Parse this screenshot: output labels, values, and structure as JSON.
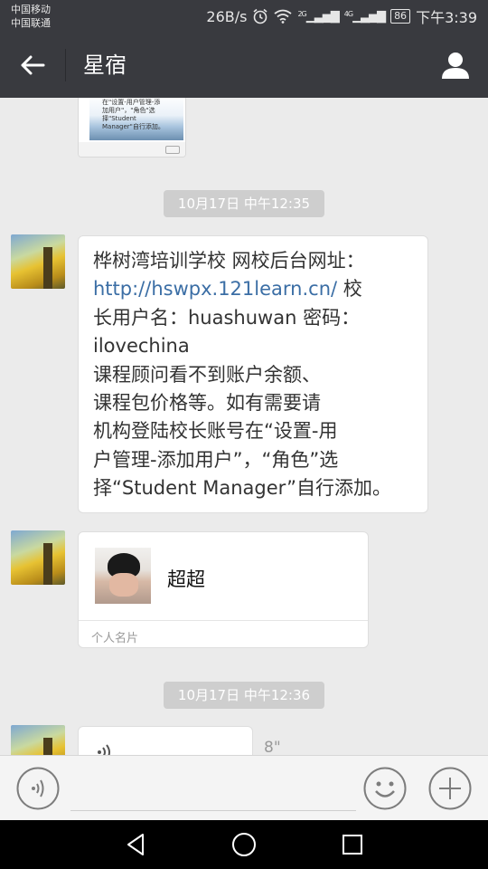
{
  "status_bar": {
    "carrier1": "中国移动",
    "carrier2": "中国联通",
    "speed": "26B/s",
    "alarm_icon": "alarm-icon",
    "wifi_icon": "wifi-icon",
    "signal1_label": "2G",
    "signal2_label": "4G",
    "battery": "86",
    "time": "下午3:39"
  },
  "header": {
    "title": "星宿",
    "back_icon": "arrow-left-icon",
    "profile_icon": "person-icon"
  },
  "messages": {
    "prev_image_text": "在\"设置-用户管理-添加用户\"，\"角色\"选择\"Student Manager\"自行添加。",
    "time1": "10月17日 中午12:35",
    "text_line1": "桦树湾培训学校 网校后台网址：",
    "text_link": "http://hswpx.121learn.cn/",
    "text_line2_tail": " 校",
    "text_line3": "长用户名：huashuwan  密码：",
    "text_line4": "ilovechina",
    "text_line5": "课程顾问看不到账户余额、",
    "text_line6": "课程包价格等。如有需要请",
    "text_line7": "机构登陆校长账号在“设置-用",
    "text_line8": "户管理-添加用户”，“角色”选",
    "text_line9": "择“Student Manager”自行添加。",
    "card_name": "超超",
    "card_footer": "个人名片",
    "time2": "10月17日 中午12:36",
    "voice_duration": "8\""
  },
  "input_bar": {
    "voice_icon": "voice-input-icon",
    "emoji_icon": "emoji-icon",
    "plus_icon": "plus-icon"
  },
  "android_nav": {
    "back": "nav-back-icon",
    "home": "nav-home-icon",
    "recent": "nav-recent-icon"
  },
  "colors": {
    "header_bg": "#393a3f",
    "chat_bg": "#ebebeb",
    "link": "#3b6ea5",
    "time_chip": "#cecece"
  }
}
